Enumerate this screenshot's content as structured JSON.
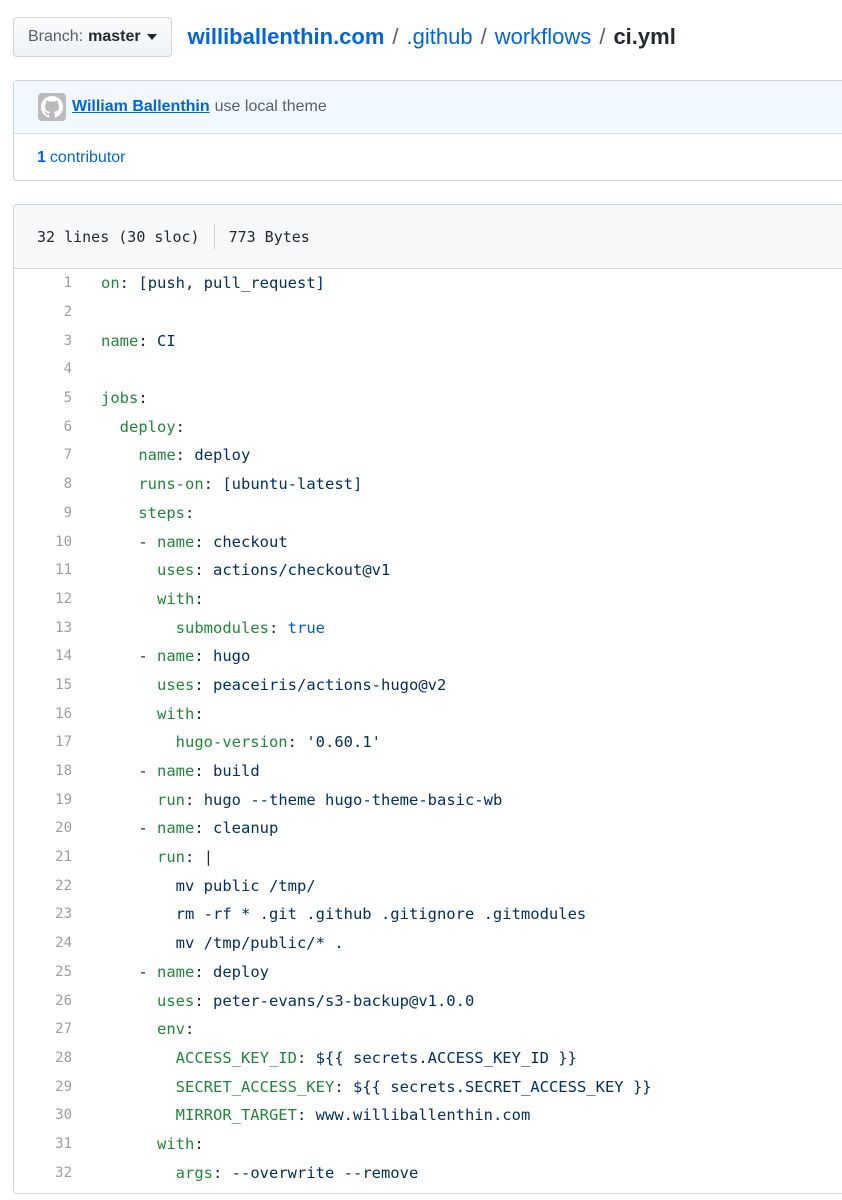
{
  "branch": {
    "label": "Branch:",
    "value": "master"
  },
  "breadcrumb": {
    "repo": "williballenthin.com",
    "parts": [
      ".github",
      "workflows"
    ],
    "file": "ci.yml",
    "separator": "/"
  },
  "commit": {
    "author": "William Ballenthin",
    "message": "use local theme",
    "avatar_icon": "github-octocat-icon",
    "contributor_count": "1",
    "contributor_label": "contributor"
  },
  "file_info": {
    "lines": "32 lines (30 sloc)",
    "size": "773 Bytes"
  },
  "code_lines": [
    {
      "n": "1",
      "indent": "",
      "key": "on",
      "after": "[push, pull_request]",
      "type": "plain",
      "dash": false
    },
    {
      "n": "2",
      "indent": "",
      "key": "",
      "after": "",
      "type": "plain",
      "dash": false
    },
    {
      "n": "3",
      "indent": "",
      "key": "name",
      "after": "CI",
      "type": "plain",
      "dash": false
    },
    {
      "n": "4",
      "indent": "",
      "key": "",
      "after": "",
      "type": "plain",
      "dash": false
    },
    {
      "n": "5",
      "indent": "",
      "key": "jobs",
      "after": "",
      "type": "plain",
      "dash": false
    },
    {
      "n": "6",
      "indent": "  ",
      "key": "deploy",
      "after": "",
      "type": "plain",
      "dash": false
    },
    {
      "n": "7",
      "indent": "    ",
      "key": "name",
      "after": "deploy",
      "type": "plain",
      "dash": false
    },
    {
      "n": "8",
      "indent": "    ",
      "key": "runs-on",
      "after": "[ubuntu-latest]",
      "type": "plain",
      "dash": false
    },
    {
      "n": "9",
      "indent": "    ",
      "key": "steps",
      "after": "",
      "type": "plain",
      "dash": false
    },
    {
      "n": "10",
      "indent": "    ",
      "key": "name",
      "after": "checkout",
      "type": "plain",
      "dash": true
    },
    {
      "n": "11",
      "indent": "      ",
      "key": "uses",
      "after": "actions/checkout@v1",
      "type": "plain",
      "dash": false
    },
    {
      "n": "12",
      "indent": "      ",
      "key": "with",
      "after": "",
      "type": "plain",
      "dash": false
    },
    {
      "n": "13",
      "indent": "        ",
      "key": "submodules",
      "after": "true",
      "type": "bool",
      "dash": false
    },
    {
      "n": "14",
      "indent": "    ",
      "key": "name",
      "after": "hugo",
      "type": "plain",
      "dash": true
    },
    {
      "n": "15",
      "indent": "      ",
      "key": "uses",
      "after": "peaceiris/actions-hugo@v2",
      "type": "plain",
      "dash": false
    },
    {
      "n": "16",
      "indent": "      ",
      "key": "with",
      "after": "",
      "type": "plain",
      "dash": false
    },
    {
      "n": "17",
      "indent": "        ",
      "key": "hugo-version",
      "after": "'0.60.1'",
      "type": "plain",
      "dash": false
    },
    {
      "n": "18",
      "indent": "    ",
      "key": "name",
      "after": "build",
      "type": "plain",
      "dash": true
    },
    {
      "n": "19",
      "indent": "      ",
      "key": "run",
      "after": "hugo --theme hugo-theme-basic-wb",
      "type": "plain",
      "dash": false
    },
    {
      "n": "20",
      "indent": "    ",
      "key": "name",
      "after": "cleanup",
      "type": "plain",
      "dash": true
    },
    {
      "n": "21",
      "indent": "      ",
      "key": "run",
      "after": "|",
      "type": "pipe",
      "dash": false
    },
    {
      "n": "22",
      "indent": "        ",
      "key": "",
      "after": "mv public /tmp/",
      "type": "plain",
      "dash": false
    },
    {
      "n": "23",
      "indent": "        ",
      "key": "",
      "after": "rm -rf * .git .github .gitignore .gitmodules",
      "type": "plain",
      "dash": false
    },
    {
      "n": "24",
      "indent": "        ",
      "key": "",
      "after": "mv /tmp/public/* .",
      "type": "plain",
      "dash": false
    },
    {
      "n": "25",
      "indent": "    ",
      "key": "name",
      "after": "deploy",
      "type": "plain",
      "dash": true
    },
    {
      "n": "26",
      "indent": "      ",
      "key": "uses",
      "after": "peter-evans/s3-backup@v1.0.0",
      "type": "plain",
      "dash": false
    },
    {
      "n": "27",
      "indent": "      ",
      "key": "env",
      "after": "",
      "type": "plain",
      "dash": false
    },
    {
      "n": "28",
      "indent": "        ",
      "key": "ACCESS_KEY_ID",
      "after": "${{ secrets.ACCESS_KEY_ID }}",
      "type": "plain",
      "dash": false
    },
    {
      "n": "29",
      "indent": "        ",
      "key": "SECRET_ACCESS_KEY",
      "after": "${{ secrets.SECRET_ACCESS_KEY }}",
      "type": "plain",
      "dash": false
    },
    {
      "n": "30",
      "indent": "        ",
      "key": "MIRROR_TARGET",
      "after": "www.williballenthin.com",
      "type": "plain",
      "dash": false
    },
    {
      "n": "31",
      "indent": "      ",
      "key": "with",
      "after": "",
      "type": "plain",
      "dash": false
    },
    {
      "n": "32",
      "indent": "        ",
      "key": "args",
      "after": "--overwrite --remove",
      "type": "plain",
      "dash": false
    }
  ],
  "colors": {
    "link": "#0366d6",
    "key": "#22863a",
    "value": "#032f62",
    "boolean": "#005cc5",
    "line_number": "#9a9ea3"
  }
}
